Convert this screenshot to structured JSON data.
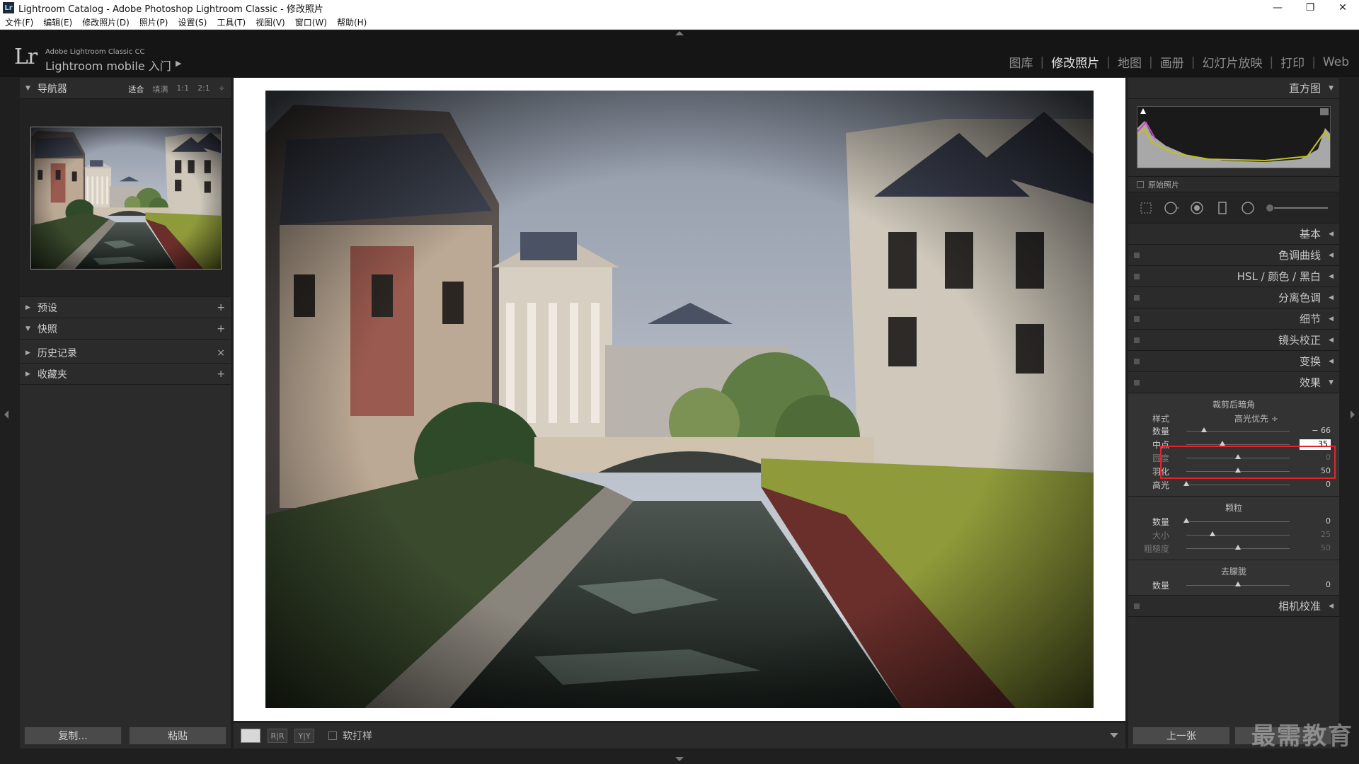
{
  "window": {
    "title": "Lightroom Catalog - Adobe Photoshop Lightroom Classic - 修改照片",
    "app_icon": "Lr",
    "controls": [
      "—",
      "❐",
      "✕"
    ]
  },
  "menu": [
    "文件(F)",
    "编辑(E)",
    "修改照片(D)",
    "照片(P)",
    "设置(S)",
    "工具(T)",
    "视图(V)",
    "窗口(W)",
    "帮助(H)"
  ],
  "identity": {
    "logo": "Lr",
    "small": "Adobe Lightroom Classic CC",
    "main": "Lightroom mobile 入门",
    "caret": "▶"
  },
  "modules": [
    "图库",
    "修改照片",
    "地图",
    "画册",
    "幻灯片放映",
    "打印",
    "Web"
  ],
  "active_module": "修改照片",
  "left": {
    "navigator": {
      "title": "导航器",
      "zoom": [
        "适合",
        "填满",
        "1:1",
        "2:1"
      ],
      "zoom_active": "适合",
      "zoom_more": "÷"
    },
    "panels": [
      {
        "title": "预设",
        "action": "+",
        "expanded": false
      },
      {
        "title": "快照",
        "action": "+",
        "expanded": true
      },
      {
        "title": "历史记录",
        "action": "×",
        "expanded": false
      },
      {
        "title": "收藏夹",
        "action": "+",
        "expanded": false
      }
    ],
    "buttons": {
      "copy": "复制...",
      "paste": "粘贴"
    }
  },
  "toolbar": {
    "view_loupe": "",
    "view_compare": "R|R",
    "view_before_after": "Y|Y",
    "soft_proof": "软打样"
  },
  "right": {
    "histogram": {
      "title": "直方图",
      "original_photo": "原始照片"
    },
    "sections": [
      "基本",
      "色调曲线",
      "HSL / 颜色 / 黑白",
      "分离色调",
      "细节",
      "镜头校正",
      "变换",
      "效果"
    ],
    "effects": {
      "vignette_title": "裁剪后暗角",
      "style_label": "样式",
      "style_value": "高光优先 ÷",
      "vignette": [
        {
          "label": "数量",
          "value": "− 66",
          "pos": 0.17,
          "dim": false,
          "edit": false
        },
        {
          "label": "中点",
          "value": "35",
          "pos": 0.35,
          "dim": false,
          "edit": true
        },
        {
          "label": "圆度",
          "value": "0",
          "pos": 0.5,
          "dim": true,
          "edit": false
        },
        {
          "label": "羽化",
          "value": "50",
          "pos": 0.5,
          "dim": false,
          "edit": false
        },
        {
          "label": "高光",
          "value": "0",
          "pos": 0.0,
          "dim": false,
          "edit": false
        }
      ],
      "grain_title": "颗粒",
      "grain": [
        {
          "label": "数量",
          "value": "0",
          "pos": 0.0,
          "dim": false
        },
        {
          "label": "大小",
          "value": "25",
          "pos": 0.25,
          "dim": true
        },
        {
          "label": "粗糙度",
          "value": "50",
          "pos": 0.5,
          "dim": true
        }
      ],
      "dehaze_title": "去朦胧",
      "dehaze": [
        {
          "label": "数量",
          "value": "0",
          "pos": 0.5,
          "dim": false
        }
      ]
    },
    "camera_calibration": "相机校准",
    "buttons": {
      "previous": "上一张"
    }
  },
  "watermark": "最需教育",
  "colors": {
    "highlight": "#e0262a",
    "panel": "#2b2b2b",
    "canvas": "#ffffff"
  }
}
